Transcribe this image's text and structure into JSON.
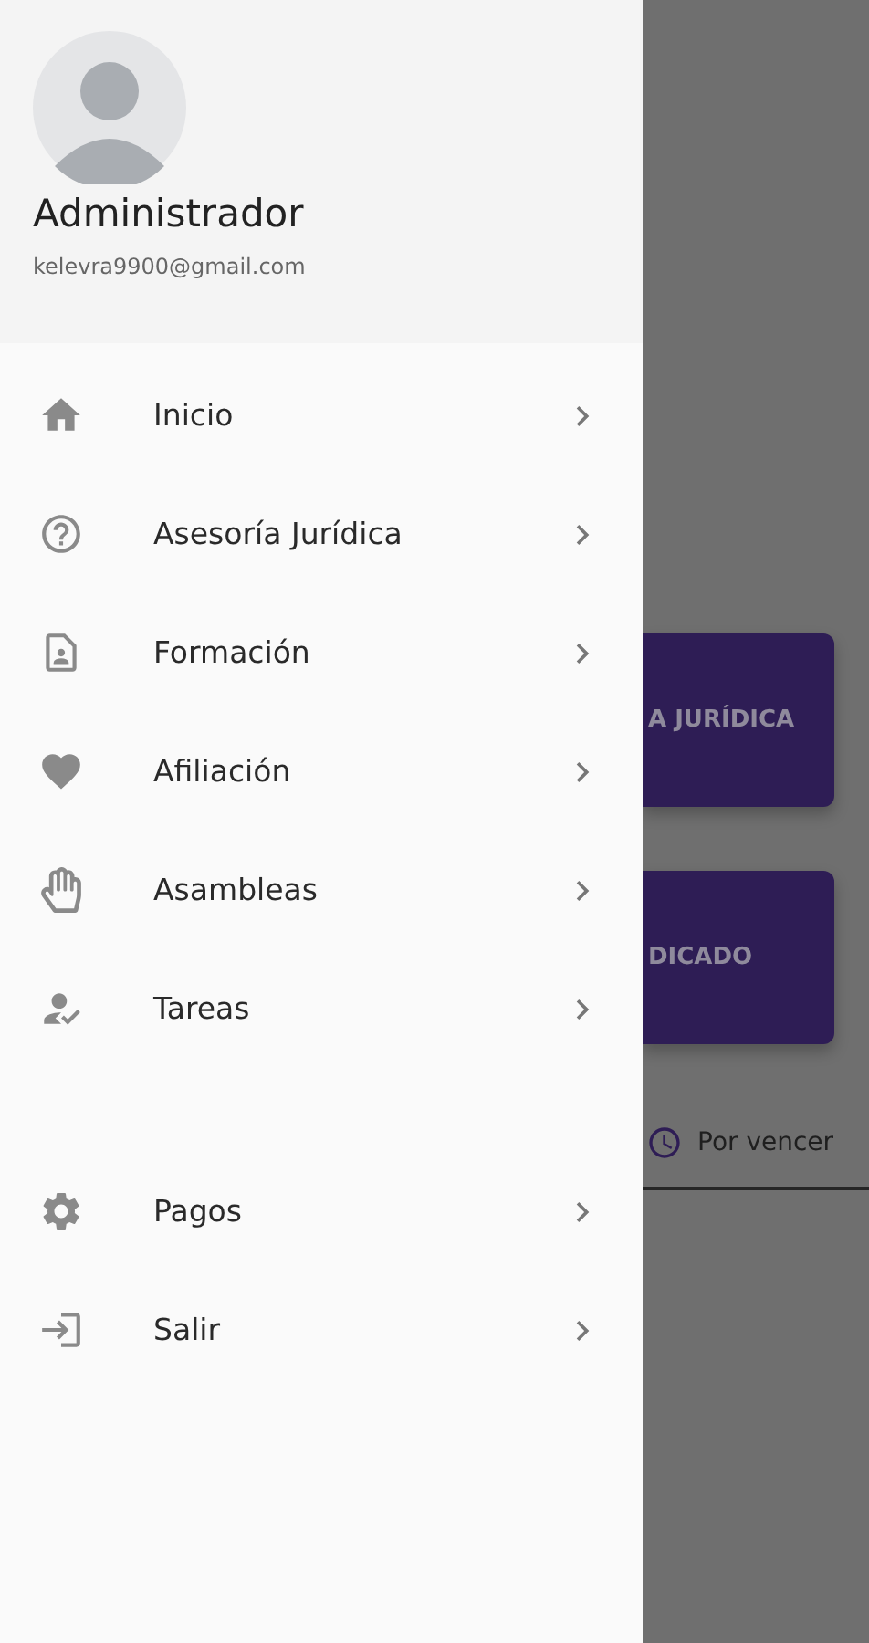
{
  "drawer": {
    "user": {
      "name": "Administrador",
      "email": "kelevra9900@gmail.com"
    },
    "groups": [
      {
        "items": [
          {
            "label": "Inicio"
          },
          {
            "label": "Asesoría Jurídica"
          },
          {
            "label": "Formación"
          },
          {
            "label": "Afiliación"
          },
          {
            "label": "Asambleas"
          },
          {
            "label": "Tareas"
          }
        ]
      },
      {
        "items": [
          {
            "label": "Pagos"
          },
          {
            "label": "Salir"
          }
        ]
      }
    ]
  },
  "background": {
    "cards": [
      {
        "label": "A JURÍDICA"
      },
      {
        "label": "DICADO"
      }
    ],
    "tab": {
      "label": "Por vencer"
    }
  }
}
